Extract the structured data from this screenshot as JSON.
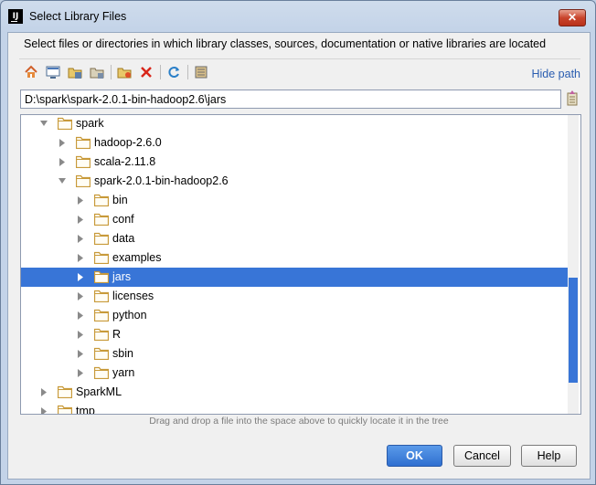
{
  "window": {
    "title": "Select Library Files",
    "close_label": "✕"
  },
  "description": "Select files or directories in which library classes, sources, documentation or native libraries are located",
  "toolbar": {
    "icons": [
      "home-icon",
      "desktop-icon",
      "project-folder-icon",
      "module-folder-icon",
      "new-folder-icon",
      "delete-icon",
      "refresh-icon",
      "show-hidden-icon"
    ],
    "hide_path_label": "Hide path"
  },
  "path": {
    "value": "D:\\spark\\spark-2.0.1-bin-hadoop2.6\\jars"
  },
  "tree": {
    "rows": [
      {
        "label": "spark",
        "level": 1,
        "expanded": true,
        "selected": false
      },
      {
        "label": "hadoop-2.6.0",
        "level": 2,
        "expanded": false,
        "selected": false
      },
      {
        "label": "scala-2.11.8",
        "level": 2,
        "expanded": false,
        "selected": false
      },
      {
        "label": "spark-2.0.1-bin-hadoop2.6",
        "level": 2,
        "expanded": true,
        "selected": false
      },
      {
        "label": "bin",
        "level": 3,
        "expanded": false,
        "selected": false
      },
      {
        "label": "conf",
        "level": 3,
        "expanded": false,
        "selected": false
      },
      {
        "label": "data",
        "level": 3,
        "expanded": false,
        "selected": false
      },
      {
        "label": "examples",
        "level": 3,
        "expanded": false,
        "selected": false
      },
      {
        "label": "jars",
        "level": 3,
        "expanded": false,
        "selected": true
      },
      {
        "label": "licenses",
        "level": 3,
        "expanded": false,
        "selected": false
      },
      {
        "label": "python",
        "level": 3,
        "expanded": false,
        "selected": false
      },
      {
        "label": "R",
        "level": 3,
        "expanded": false,
        "selected": false
      },
      {
        "label": "sbin",
        "level": 3,
        "expanded": false,
        "selected": false
      },
      {
        "label": "yarn",
        "level": 3,
        "expanded": false,
        "selected": false
      },
      {
        "label": "SparkML",
        "level": 1,
        "expanded": false,
        "selected": false
      },
      {
        "label": "tmp",
        "level": 1,
        "expanded": false,
        "selected": false
      }
    ]
  },
  "hint": "Drag and drop a file into the space above to quickly locate it in the tree",
  "buttons": {
    "ok": "OK",
    "cancel": "Cancel",
    "help": "Help"
  },
  "colors": {
    "selection": "#3875d7",
    "link": "#2a5db0",
    "folder": "#c89a3a"
  }
}
